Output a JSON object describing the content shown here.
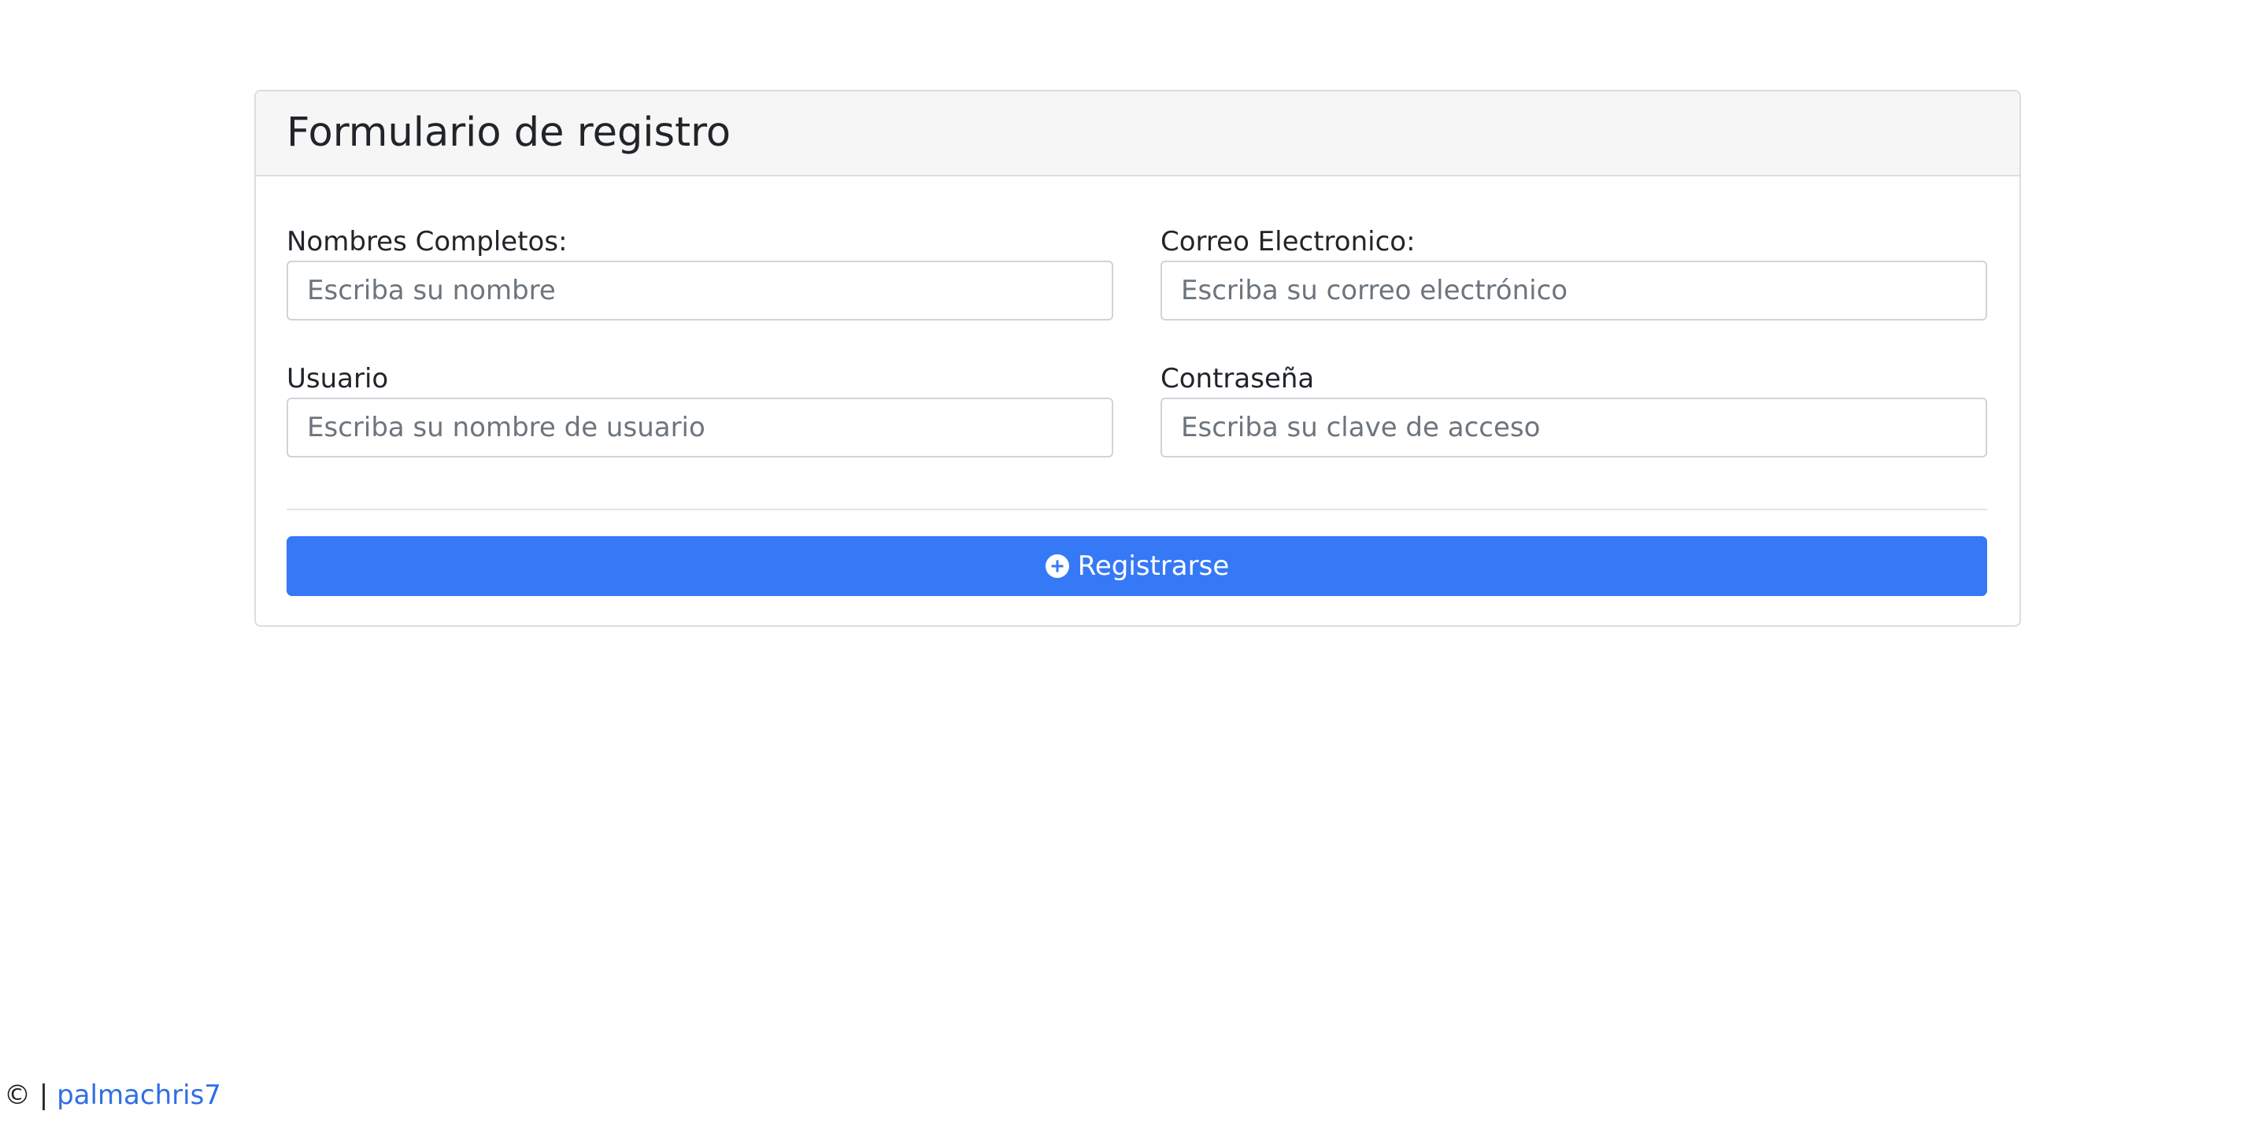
{
  "form": {
    "title": "Formulario de registro",
    "fields": {
      "full_name": {
        "label": "Nombres Completos:",
        "placeholder": "Escriba su nombre",
        "value": ""
      },
      "email": {
        "label": "Correo Electronico:",
        "placeholder": "Escriba su correo electrónico",
        "value": ""
      },
      "username": {
        "label": "Usuario",
        "placeholder": "Escriba su nombre de usuario",
        "value": ""
      },
      "password": {
        "label": "Contraseña",
        "placeholder": "Escriba su clave de acceso",
        "value": ""
      }
    },
    "submit": {
      "label": "Registrarse",
      "icon": "plus-circle-icon"
    }
  },
  "footer": {
    "prefix": "© |",
    "link_text": "palmachris7"
  },
  "colors": {
    "primary": "#3679f6",
    "link": "#2f6ee6",
    "header_bg": "#f6f6f6",
    "border": "#dddddd"
  }
}
